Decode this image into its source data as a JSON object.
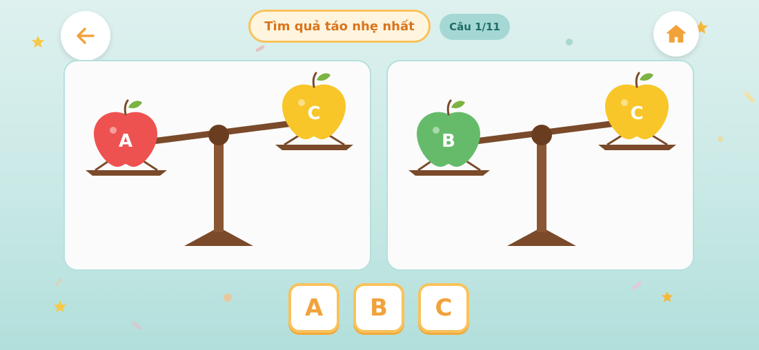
{
  "header": {
    "title": "Tìm quả táo nhẹ nhất",
    "question_counter": "Câu 1/11",
    "back_icon": "arrow-left-icon",
    "home_icon": "home-icon"
  },
  "scales": [
    {
      "left_apple": {
        "label": "A",
        "color": "#ee5250"
      },
      "right_apple": {
        "label": "C",
        "color": "#f8c628"
      }
    },
    {
      "left_apple": {
        "label": "B",
        "color": "#66bb6a"
      },
      "right_apple": {
        "label": "C",
        "color": "#f8c628"
      }
    }
  ],
  "answers": [
    "A",
    "B",
    "C"
  ],
  "colors": {
    "accent": "#f2a23b",
    "wood": "#7a4a2a",
    "panel_border": "#b5e0dc",
    "background": "#c9e9e6"
  }
}
